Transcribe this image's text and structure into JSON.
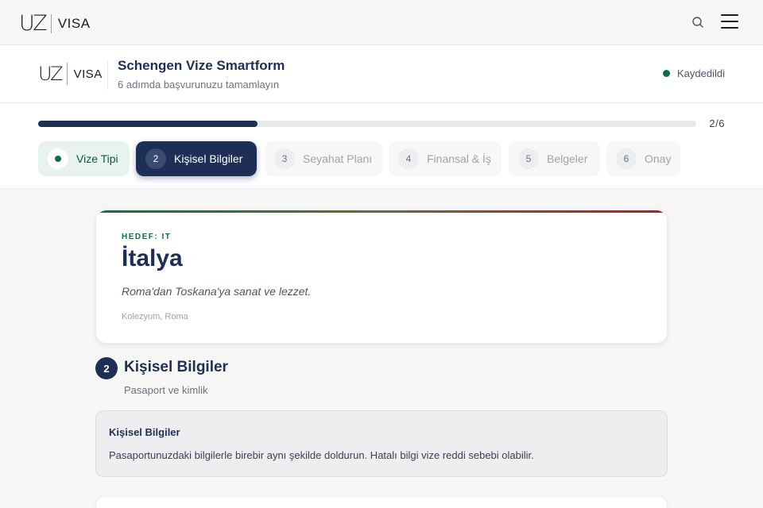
{
  "brand": {
    "mark": "UZ",
    "word": "VISA"
  },
  "form": {
    "title": "Schengen Vize Smartform",
    "subtitle": "6 adımda başvurunuzu tamamlayın",
    "save_status": "Kaydedildi"
  },
  "progress": {
    "value": 0.333,
    "label": "2/6"
  },
  "steps": [
    {
      "num": "",
      "label": "Vize Tipi",
      "state": "done"
    },
    {
      "num": "2",
      "label": "Kişisel Bilgiler",
      "state": "active"
    },
    {
      "num": "3",
      "label": "Seyahat Planı",
      "state": "pending"
    },
    {
      "num": "4",
      "label": "Finansal & İş",
      "state": "pending"
    },
    {
      "num": "5",
      "label": "Belgeler",
      "state": "pending"
    },
    {
      "num": "6",
      "label": "Onay",
      "state": "pending"
    }
  ],
  "destination": {
    "tag": "HEDEF: IT",
    "name": "İtalya",
    "description": "Roma'dan Toskana'ya sanat ve lezzet.",
    "caption": "Kolezyum, Roma"
  },
  "section": {
    "number": "2",
    "title": "Kişisel Bilgiler",
    "subtitle": "Pasaport ve kimlik"
  },
  "info": {
    "title": "Kişisel Bilgiler",
    "text": "Pasaportunuzdaki bilgilerle birebir aynı şekilde doldurun. Hatalı bilgi vize reddi sebebi olabilir."
  },
  "icons": {
    "search": "search-icon",
    "menu": "hamburger-menu-icon",
    "status": "status-dot-icon"
  },
  "colors": {
    "navy": "#1e2f55",
    "green": "#0f6e47",
    "red": "#b91c1c"
  }
}
